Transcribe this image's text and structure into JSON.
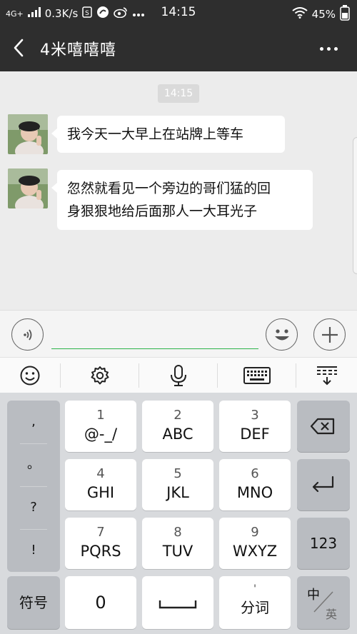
{
  "status_bar": {
    "network": "4G+",
    "speed": "0.3K/s",
    "time": "14:15",
    "battery": "45%"
  },
  "header": {
    "title": "4米嘻嘻嘻"
  },
  "chat": {
    "time_label": "14:15",
    "messages": [
      {
        "text_line1": "我今天一大早上在站牌上等车"
      },
      {
        "text_line1": "忽然就看见一个旁边的哥们猛的回",
        "text_line2": "身狠狠地给后面那人一大耳光子"
      }
    ]
  },
  "input": {
    "value": "",
    "placeholder": ""
  },
  "keyboard": {
    "punct": [
      ",",
      "。",
      "?",
      "!"
    ],
    "keys": [
      {
        "num": "1",
        "letters": "@-_/"
      },
      {
        "num": "2",
        "letters": "ABC"
      },
      {
        "num": "3",
        "letters": "DEF"
      },
      {
        "num": "4",
        "letters": "GHI"
      },
      {
        "num": "5",
        "letters": "JKL"
      },
      {
        "num": "6",
        "letters": "MNO"
      },
      {
        "num": "7",
        "letters": "PQRS"
      },
      {
        "num": "8",
        "letters": "TUV"
      },
      {
        "num": "9",
        "letters": "WXYZ"
      }
    ],
    "num_key": "123",
    "symbols": "符号",
    "zero": "0",
    "fenci_top": "'",
    "fenci": "分词",
    "lang_top": "中",
    "lang_bottom": "英"
  },
  "colors": {
    "header_bg": "#2e2e2e",
    "chat_bg": "#ececec",
    "input_accent": "#2bb44a",
    "keyboard_bg": "#d8dadd"
  },
  "icons": [
    "back-arrow-icon",
    "more-dots-icon",
    "voice-icon",
    "emoji-icon",
    "plus-icon",
    "smiley-icon",
    "gear-icon",
    "microphone-icon",
    "keyboard-icon",
    "collapse-keyboard-icon",
    "backspace-icon",
    "enter-icon",
    "space-icon"
  ]
}
